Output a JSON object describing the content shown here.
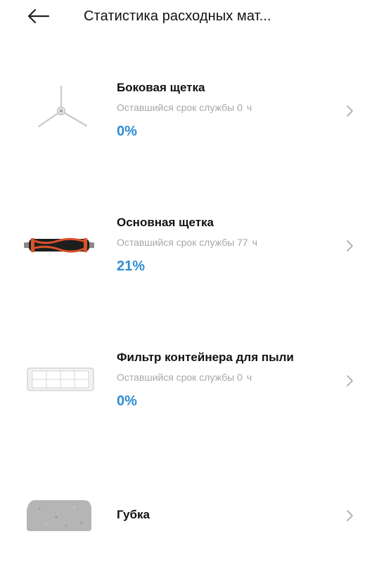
{
  "header": {
    "title": "Статистика расходных мат...",
    "back_icon": "arrow-left-icon"
  },
  "items": [
    {
      "name": "Боковая щетка",
      "life_label": "Оставшийся срок службы",
      "life_value": "0",
      "life_unit": "ч",
      "percent": "0%",
      "percent_value": 0,
      "icon": "side-brush-icon"
    },
    {
      "name": "Основная щетка",
      "life_label": "Оставшийся срок службы",
      "life_value": "77",
      "life_unit": "ч",
      "percent": "21%",
      "percent_value": 21,
      "icon": "main-brush-icon"
    },
    {
      "name": "Фильтр контейнера для пыли",
      "life_label": "Оставшийся срок службы",
      "life_value": "0",
      "life_unit": "ч",
      "percent": "0%",
      "percent_value": 0,
      "icon": "dust-filter-icon"
    },
    {
      "name": "Губка",
      "icon": "sponge-icon"
    }
  ],
  "colors": {
    "percent": "#2f8cd3",
    "secondary_text": "#a7a7a7",
    "main_brush_bristles": "#d9532b"
  }
}
